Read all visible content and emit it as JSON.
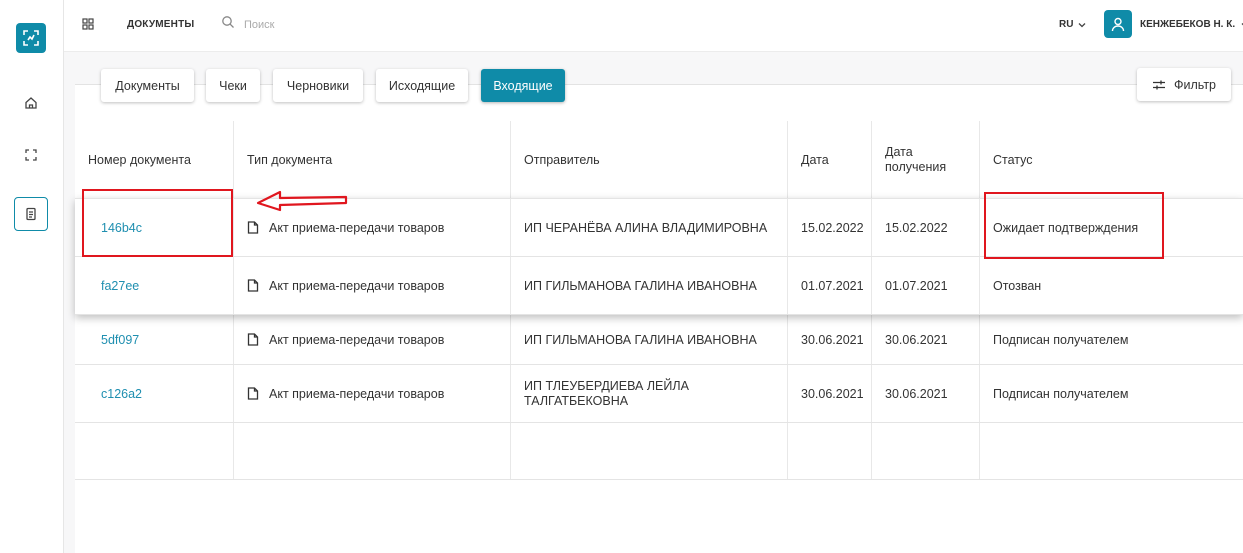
{
  "topbar": {
    "section_title": "ДОКУМЕНТЫ",
    "search_placeholder": "Поиск",
    "language": "RU",
    "user_name": "КЕНЖЕБЕКОВ Н. К."
  },
  "tabs": [
    {
      "label": "Документы",
      "active": false
    },
    {
      "label": "Чеки",
      "active": false
    },
    {
      "label": "Черновики",
      "active": false
    },
    {
      "label": "Исходящие",
      "active": false
    },
    {
      "label": "Входящие",
      "active": true
    }
  ],
  "filter_label": "Фильтр",
  "table": {
    "columns": [
      "Номер документа",
      "Тип документа",
      "Отправитель",
      "Дата",
      "Дата получения",
      "Статус"
    ],
    "rows": [
      {
        "number": "146b4c",
        "type": "Акт приема-передачи товаров",
        "sender": "ИП ЧЕРАНЁВА АЛИНА ВЛАДИМИРОВНА",
        "date": "15.02.2022",
        "received": "15.02.2022",
        "status": "Ожидает подтверждения"
      },
      {
        "number": "fa27ee",
        "type": "Акт приема-передачи товаров",
        "sender": "ИП ГИЛЬМАНОВА ГАЛИНА ИВАНОВНА",
        "date": "01.07.2021",
        "received": "01.07.2021",
        "status": "Отозван"
      },
      {
        "number": "5df097",
        "type": "Акт приема-передачи товаров",
        "sender": "ИП ГИЛЬМАНОВА ГАЛИНА ИВАНОВНА",
        "date": "30.06.2021",
        "received": "30.06.2021",
        "status": "Подписан получателем"
      },
      {
        "number": "c126a2",
        "type": "Акт приема-передачи товаров",
        "sender": "ИП ТЛЕУБЕРДИЕВА ЛЕЙЛА ТАЛГАТБЕКОВНА",
        "date": "30.06.2021",
        "received": "30.06.2021",
        "status": "Подписан получателем"
      }
    ]
  },
  "colors": {
    "accent": "#0f8ba8",
    "link": "#1f8fb0",
    "annotation": "#e0161e"
  }
}
